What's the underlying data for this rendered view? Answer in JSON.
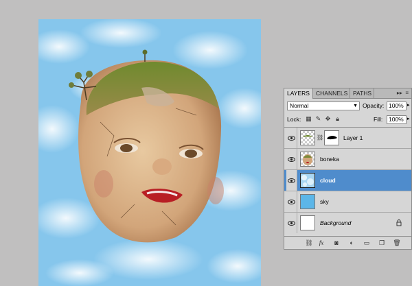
{
  "canvas": {
    "content": "doll head on cloud background"
  },
  "layers_panel": {
    "tabs": [
      {
        "label": "LAYERS",
        "active": true
      },
      {
        "label": "CHANNELS",
        "active": false
      },
      {
        "label": "PATHS",
        "active": false
      }
    ],
    "menu_icon": "double-arrow-menu-icon",
    "blend_mode": "Normal",
    "opacity_label": "Opacity:",
    "opacity_value": "100%",
    "lock_label": "Lock:",
    "fill_label": "Fill:",
    "fill_value": "100%",
    "layers": [
      {
        "name": "Layer 1",
        "selected": false,
        "has_mask": true,
        "thumb": "tree-hair"
      },
      {
        "name": "boneka",
        "selected": false,
        "thumb": "doll-face"
      },
      {
        "name": "cloud",
        "selected": true,
        "thumb": "clouds"
      },
      {
        "name": "sky",
        "selected": false,
        "thumb": "blue-fill"
      },
      {
        "name": "Background",
        "selected": false,
        "italic": true,
        "locked": true,
        "thumb": "white-fill"
      }
    ],
    "accent_color": "#4f8ccc",
    "bottom_icons": [
      "link-icon",
      "fx-icon",
      "mask-icon",
      "adjustment-icon",
      "group-icon",
      "new-layer-icon",
      "trash-icon"
    ]
  }
}
